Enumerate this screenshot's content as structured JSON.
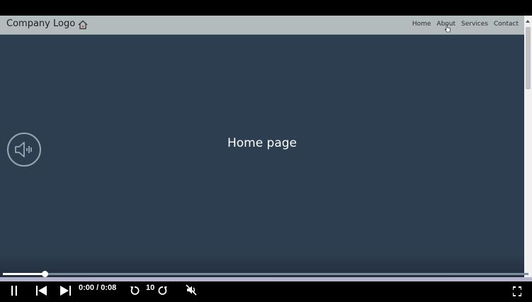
{
  "navbar": {
    "logo_text": "Company Logo",
    "logo_icon": "home-icon",
    "links": [
      "Home",
      "About",
      "Services",
      "Contact"
    ]
  },
  "main": {
    "title": "Home page",
    "speaker_icon": "speaker-icon"
  },
  "player": {
    "current_time": "0:00",
    "separator": "/",
    "duration": "0:08",
    "skip_seconds": "10",
    "progress_fraction": 0.08,
    "icons": [
      "pause-icon",
      "previous-icon",
      "play-icon",
      "rewind-icon",
      "forward-icon",
      "mute-icon",
      "fullscreen-icon"
    ]
  },
  "colors": {
    "page_bg": "#2d3e50",
    "navbar_bg": "#b3bbbd",
    "controls_bg": "#000000",
    "progress_strip": "#b3b4cc"
  }
}
